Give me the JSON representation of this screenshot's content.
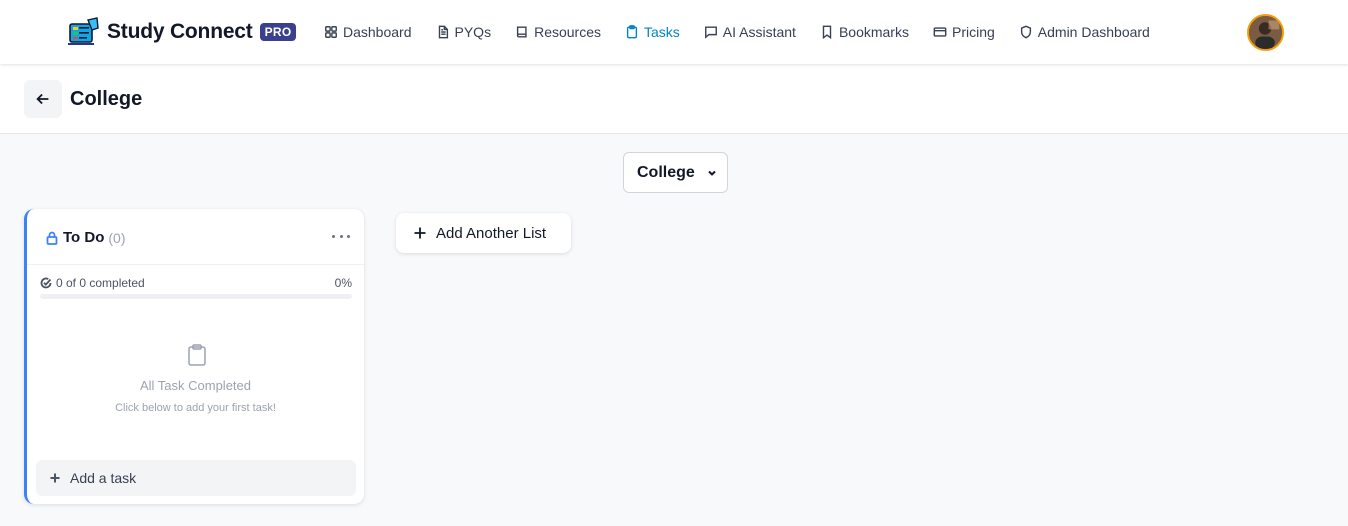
{
  "header": {
    "brand_name": "Study Connect",
    "brand_badge": "PRO",
    "nav": [
      {
        "label": "Dashboard",
        "icon": "grid-icon",
        "active": false
      },
      {
        "label": "PYQs",
        "icon": "file-text-icon",
        "active": false
      },
      {
        "label": "Resources",
        "icon": "book-icon",
        "active": false
      },
      {
        "label": "Tasks",
        "icon": "clipboard-icon",
        "active": true
      },
      {
        "label": "AI Assistant",
        "icon": "message-square-icon",
        "active": false
      },
      {
        "label": "Bookmarks",
        "icon": "bookmark-icon",
        "active": false
      },
      {
        "label": "Pricing",
        "icon": "credit-card-icon",
        "active": false
      },
      {
        "label": "Admin Dashboard",
        "icon": "shield-icon",
        "active": false
      }
    ],
    "avatar_icon": "user-avatar"
  },
  "page": {
    "title": "College",
    "back_icon": "arrow-left-icon"
  },
  "board_select": {
    "value": "College"
  },
  "lists": [
    {
      "name": "To Do",
      "count": "(0)",
      "progress_text": "0 of 0 completed",
      "progress_percent_text": "0%",
      "progress_fraction": 0,
      "empty_title": "All Task Completed",
      "empty_subtitle": "Click below to add your first task!",
      "add_task_label": "Add a task"
    }
  ],
  "add_list_label": "Add Another List",
  "colors": {
    "accent": "#3b82f6",
    "active_nav": "#0284c7",
    "pro_badge": "#3b3f8f"
  }
}
